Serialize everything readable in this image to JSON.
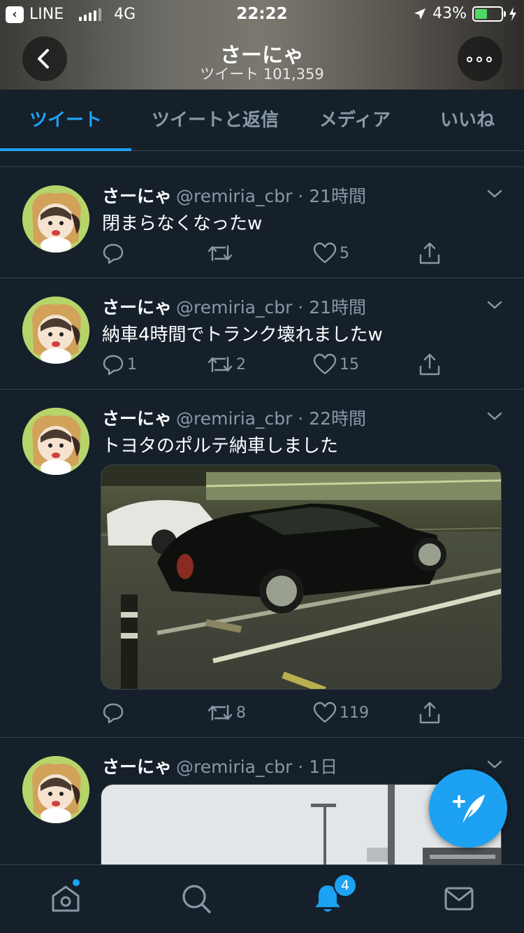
{
  "status_bar": {
    "back_app": "LINE",
    "network": "4G",
    "time": "22:22",
    "battery_percent": "43%",
    "battery_level": 0.43
  },
  "header": {
    "title": "さーにゃ",
    "subtitle": "ツイート 101,359"
  },
  "tabs": [
    {
      "label": "ツイート",
      "active": true
    },
    {
      "label": "ツイートと返信",
      "active": false
    },
    {
      "label": "メディア",
      "active": false
    },
    {
      "label": "いいね",
      "active": false
    }
  ],
  "tweets": [
    {
      "name": "さーにゃ",
      "handle": "@remiria_cbr · 21時間",
      "text": "閉まらなくなったw",
      "replies": "",
      "retweets": "",
      "likes": "5"
    },
    {
      "name": "さーにゃ",
      "handle": "@remiria_cbr · 21時間",
      "text": "納車4時間でトランク壊れましたw",
      "replies": "1",
      "retweets": "2",
      "likes": "15"
    },
    {
      "name": "さーにゃ",
      "handle": "@remiria_cbr · 22時間",
      "text": "トヨタのポルテ納車しました",
      "replies": "",
      "retweets": "8",
      "likes": "119",
      "media": "photo of black sedan in parking lot at night"
    },
    {
      "name": "さーにゃ",
      "handle": "@remiria_cbr · 1日",
      "text": "",
      "media": "photo of sky with street lamp"
    }
  ],
  "bottom_nav": {
    "notifications_badge": "4"
  },
  "colors": {
    "background": "#15202b",
    "accent": "#1da1f2",
    "muted": "#8899a6",
    "divider": "#38444d"
  }
}
